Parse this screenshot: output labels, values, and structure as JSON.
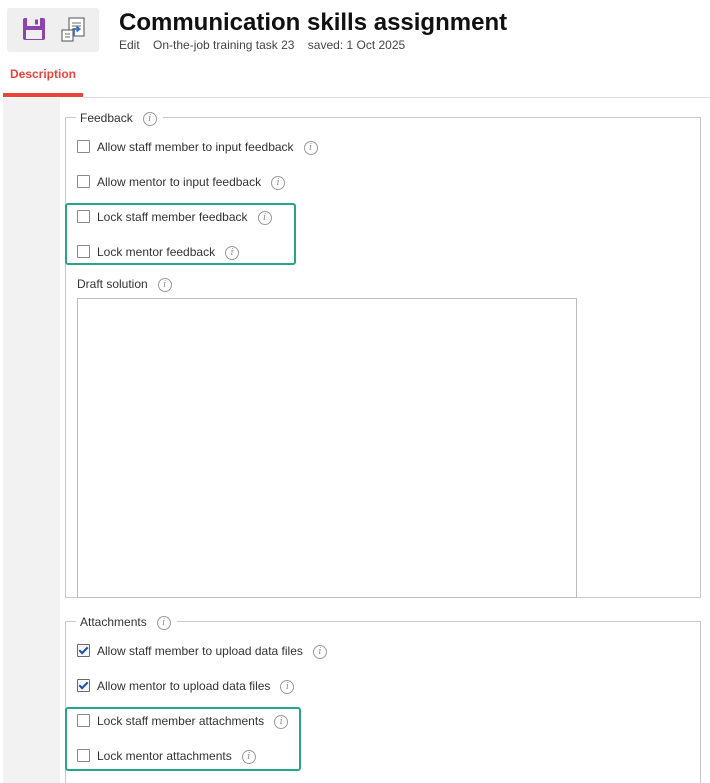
{
  "header": {
    "title": "Communication skills assignment",
    "meta": {
      "mode": "Edit",
      "task": "On-the-job training task 23",
      "saved": "saved: 1 Oct 2025"
    }
  },
  "toolbar": {
    "save_icon": "floppy-disk-icon",
    "export_icon": "document-export-icon"
  },
  "tabs": [
    {
      "label": "Description",
      "active": true
    }
  ],
  "colors": {
    "accent": "#e8443a",
    "highlight": "#26a58a",
    "save_icon": "#8e44ad",
    "export_icon": "#3a6fc4"
  },
  "feedback": {
    "legend": "Feedback",
    "options": [
      {
        "label": "Allow staff member to input feedback",
        "checked": false
      },
      {
        "label": "Allow mentor to input feedback",
        "checked": false
      },
      {
        "label": "Lock staff member feedback",
        "checked": false
      },
      {
        "label": "Lock mentor feedback",
        "checked": false
      }
    ],
    "draft_label": "Draft solution",
    "draft_value": ""
  },
  "attachments": {
    "legend": "Attachments",
    "options": [
      {
        "label": "Allow staff member to upload data files",
        "checked": true
      },
      {
        "label": "Allow mentor to upload data files",
        "checked": true
      },
      {
        "label": "Lock staff member attachments",
        "checked": false
      },
      {
        "label": "Lock mentor attachments",
        "checked": false
      }
    ]
  },
  "info_glyph": "i"
}
